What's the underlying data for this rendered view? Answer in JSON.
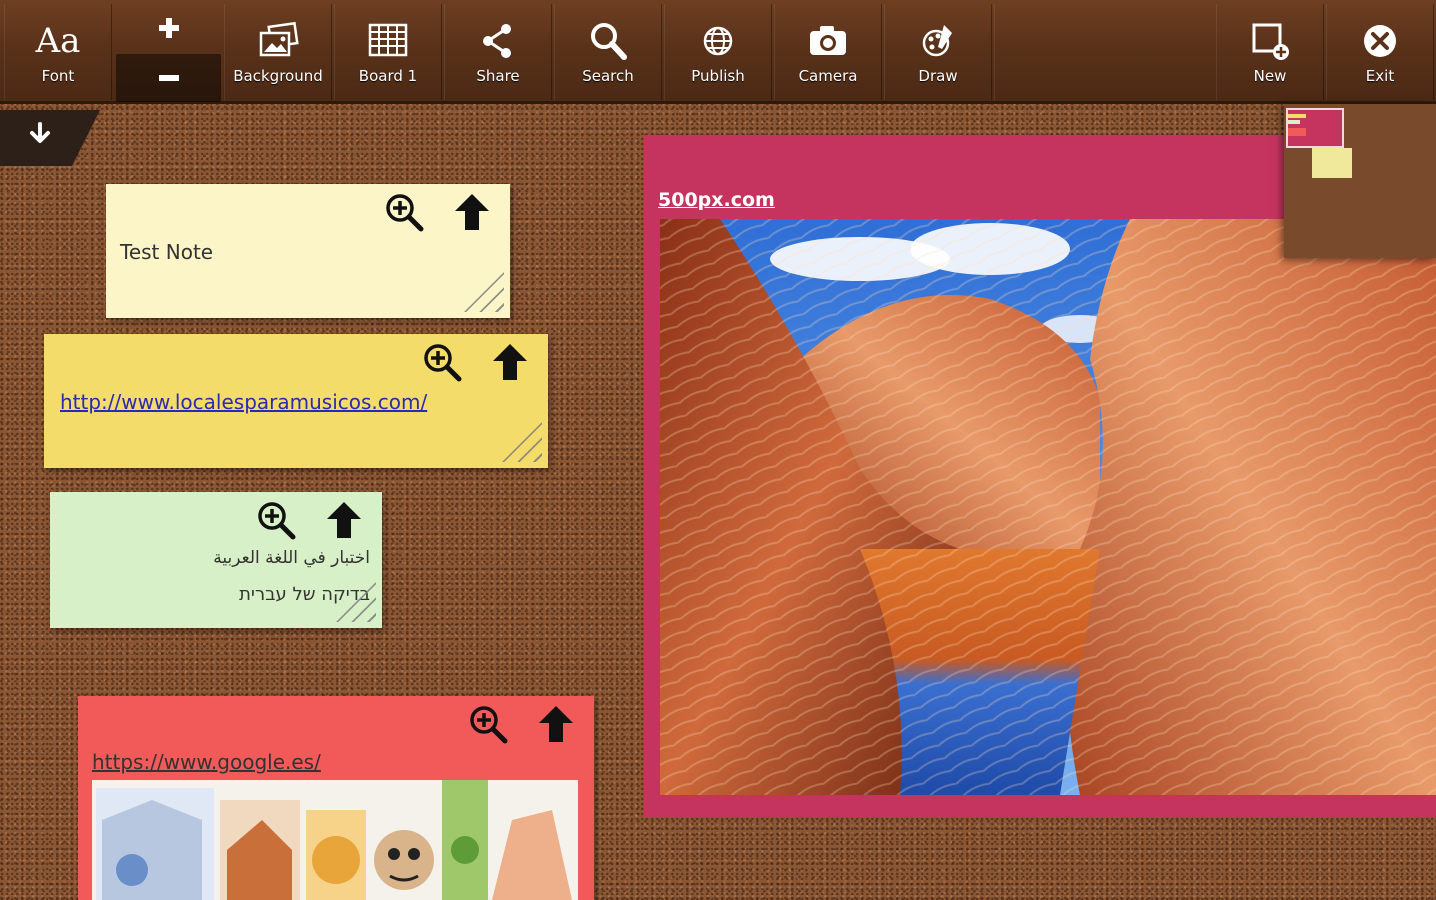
{
  "toolbar": {
    "font": "Font",
    "background": "Background",
    "board": "Board 1",
    "share": "Share",
    "search": "Search",
    "publish": "Publish",
    "camera": "Camera",
    "draw": "Draw",
    "new": "New",
    "exit": "Exit",
    "font_glyph": "Aa"
  },
  "notes": {
    "note1": {
      "text": "Test Note",
      "color": "#fbf5c8"
    },
    "note2": {
      "link": "http://www.localesparamusicos.com/",
      "color": "#f3dc6a"
    },
    "note3": {
      "line1": "اختبار في اللغة العربية",
      "line2": "בדיקה של עברית",
      "color": "#d8f0c8"
    },
    "note4": {
      "link": "https://www.google.es/",
      "color": "#f25a5a"
    }
  },
  "image_note": {
    "link": "500px.com",
    "color": "#c4345f"
  },
  "icons": [
    "font-icon",
    "plus-icon",
    "minus-icon",
    "background-icon",
    "board-icon",
    "share-icon",
    "search-icon",
    "publish-icon",
    "camera-icon",
    "draw-icon",
    "new-icon",
    "exit-icon",
    "download-icon",
    "zoom-in-icon",
    "arrow-up-icon",
    "resize-handle-icon"
  ]
}
